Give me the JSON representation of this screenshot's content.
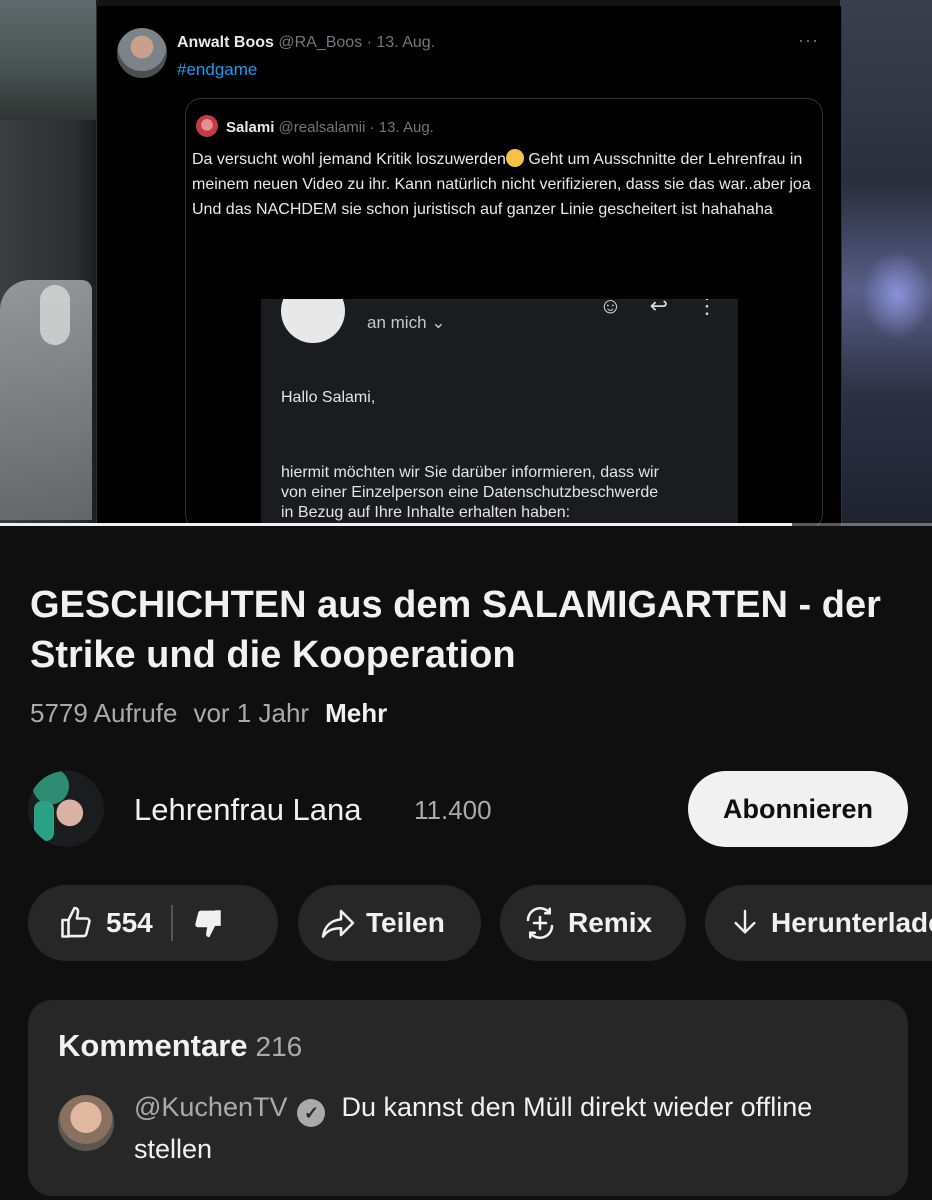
{
  "player": {
    "progress_percent": 85,
    "tweet": {
      "author_name": "Anwalt Boos",
      "author_meta": "@RA_Boos · 13. Aug.",
      "hashtag": "#endgame",
      "more_icon": "ellipsis-icon",
      "quoted": {
        "author_name": "Salami",
        "author_meta": "@realsalamii · 13. Aug.",
        "text_part1": "Da versucht wohl jemand Kritik loszuwerden",
        "text_part2": " Geht um Ausschnitte der Lehrenfrau in meinem neuen Video zu ihr. Kann natürlich nicht verifizieren, dass sie das war..aber joa\nUnd das NACHDEM sie schon juristisch auf ganzer Linie gescheitert ist hahahaha",
        "email": {
          "to_label": "an mich ⌄",
          "greeting": "Hallo Salami,",
          "body": "hiermit möchten wir Sie darüber informieren, dass wir\nvon einer Einzelperson eine Datenschutzbeschwerde\nin Bezug auf Ihre Inhalte erhalten haben:"
        }
      }
    }
  },
  "video": {
    "title": "GESCHICHTEN aus dem SALAMIGARTEN - der Strike und die Kooperation",
    "views": "5779 Aufrufe",
    "age": "vor 1 Jahr",
    "more_label": "Mehr"
  },
  "channel": {
    "name": "Lehrenfrau Lana",
    "subscribers": "11.400",
    "subscribe_label": "Abonnieren"
  },
  "actions": {
    "like_count": "554",
    "share_label": "Teilen",
    "remix_label": "Remix",
    "download_label": "Herunterladen"
  },
  "comments": {
    "heading": "Kommentare",
    "count": "216",
    "top_comment": {
      "user": "@KuchenTV",
      "verified_glyph": "✓",
      "text": "Du kannst den Müll direkt wieder offline stellen"
    }
  },
  "colors": {
    "background": "#0f0f0f",
    "pill": "#272727",
    "subscribe_bg": "#f1f1f1",
    "link_blue": "#1d9bf0"
  }
}
